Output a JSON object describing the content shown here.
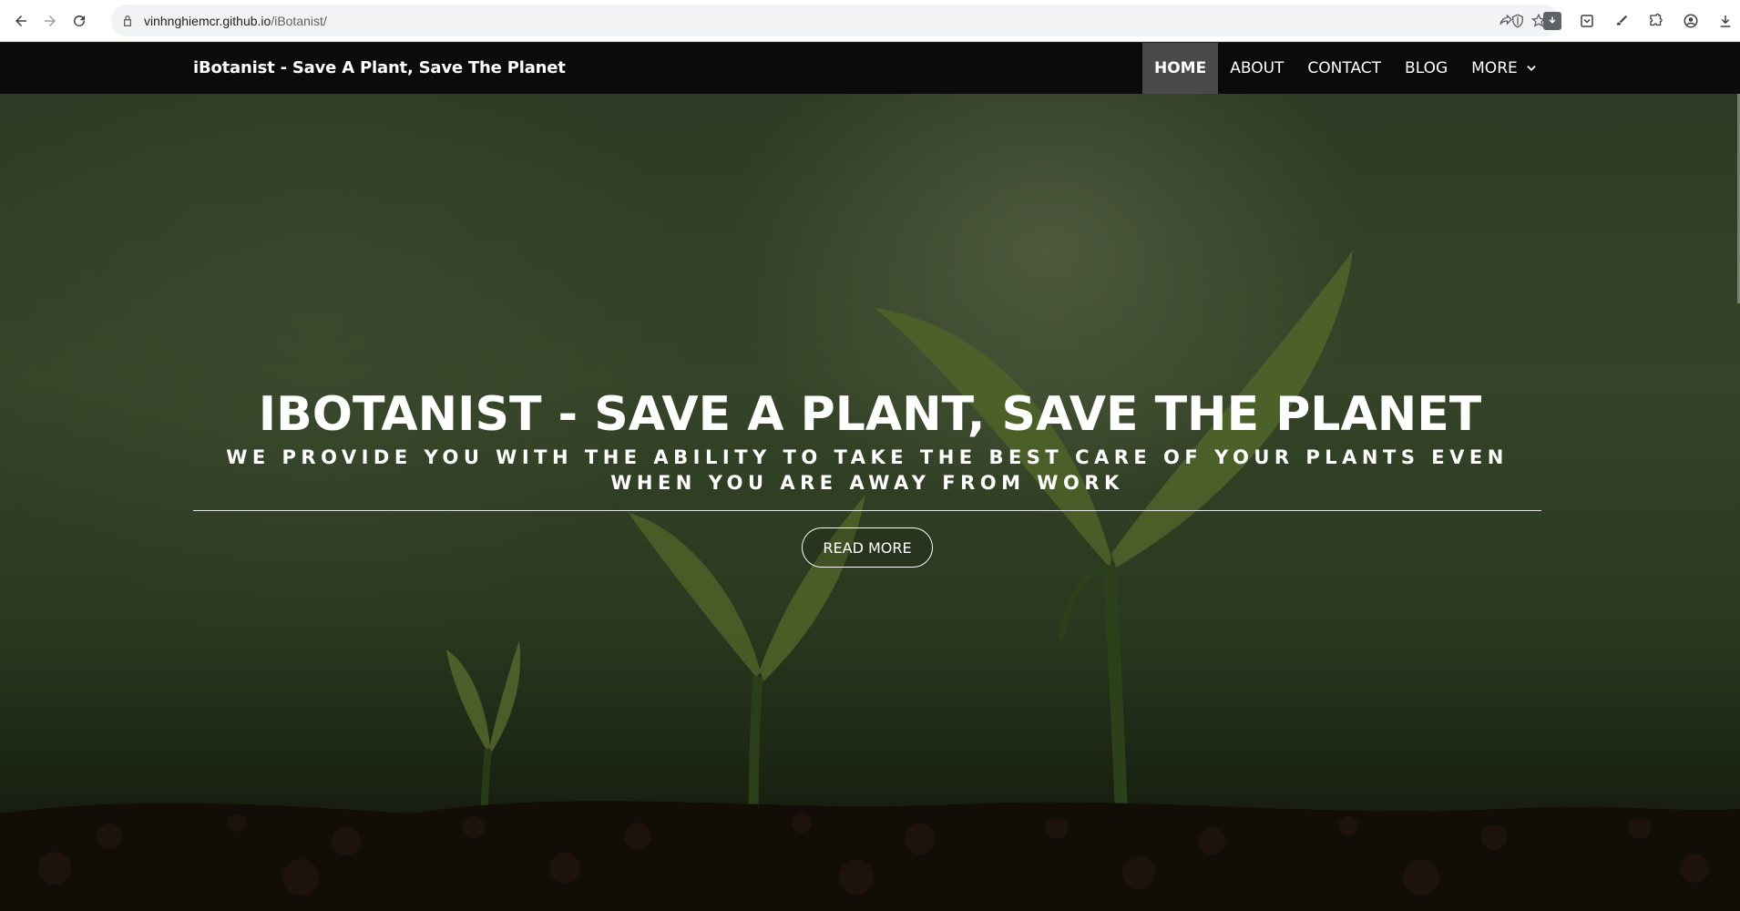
{
  "browser": {
    "url_host": "vinhnghiemcr.github.io",
    "url_path": "/iBotanist/"
  },
  "site": {
    "brand": "iBotanist - Save A Plant, Save The Planet",
    "nav": [
      {
        "label": "HOME",
        "active": true
      },
      {
        "label": "ABOUT",
        "active": false
      },
      {
        "label": "CONTACT",
        "active": false
      },
      {
        "label": "BLOG",
        "active": false
      },
      {
        "label": "MORE",
        "active": false
      }
    ]
  },
  "hero": {
    "title": "IBOTANIST - SAVE A PLANT, SAVE THE PLANET",
    "subtitle": "WE PROVIDE YOU WITH THE ABILITY TO TAKE THE BEST CARE OF YOUR PLANTS EVEN WHEN YOU ARE AWAY FROM WORK",
    "button_label": "READ MORE"
  },
  "colors": {
    "header_bg": "#0b0b0b",
    "nav_active_bg": "#4a4a4a",
    "hero_text": "#ffffff"
  }
}
